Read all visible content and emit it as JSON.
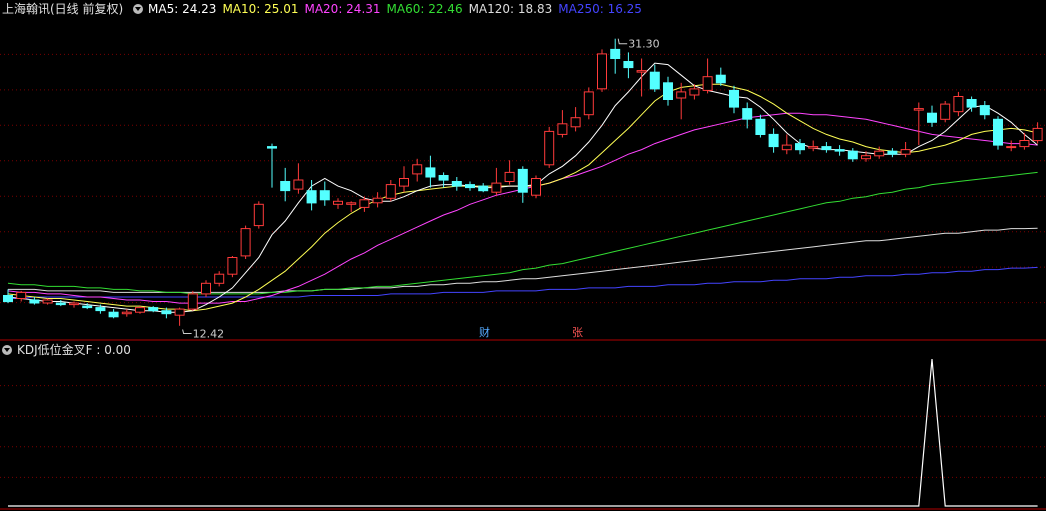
{
  "main_legend": {
    "title": "上海翰讯(日线 前复权)",
    "items": [
      {
        "label": "MA5: 24.23",
        "color": "#ffffff"
      },
      {
        "label": "MA10: 25.01",
        "color": "#ffff55"
      },
      {
        "label": "MA20: 24.31",
        "color": "#ff44ff"
      },
      {
        "label": "MA60: 22.46",
        "color": "#33dd33"
      },
      {
        "label": "MA120: 18.83",
        "color": "#dddddd"
      },
      {
        "label": "MA250: 16.25",
        "color": "#4444ff"
      }
    ]
  },
  "sub_legend": {
    "title": "KDJ低位金叉F : 0.00"
  },
  "events": [
    {
      "label": "财",
      "color": "#55aaff"
    },
    {
      "label": "张",
      "color": "#ff5555"
    }
  ],
  "colors": {
    "up": "#ff3b3b",
    "down": "#54ffff",
    "grid": "#7a0000",
    "border": "#b00000"
  },
  "chart_data": [
    {
      "type": "candlestick",
      "title": "上海翰讯(日线 前复权)",
      "y_range": [
        11.6,
        32.6
      ],
      "annotations": [
        {
          "label": "12.42",
          "kind": "low",
          "value": 12.42
        },
        {
          "label": "31.30",
          "kind": "high",
          "value": 31.3
        }
      ],
      "candles": [
        [
          14.4,
          14.0,
          14.8,
          13.9
        ],
        [
          14.2,
          14.6,
          14.7,
          14.0
        ],
        [
          14.1,
          13.9,
          14.3,
          13.8
        ],
        [
          13.9,
          14.1,
          14.2,
          13.8
        ],
        [
          13.9,
          13.8,
          14.1,
          13.7
        ],
        [
          13.8,
          13.9,
          14.0,
          13.6
        ],
        [
          13.7,
          13.6,
          13.9,
          13.5
        ],
        [
          13.6,
          13.4,
          13.8,
          13.2
        ],
        [
          13.3,
          13.0,
          13.5,
          12.9
        ],
        [
          13.2,
          13.3,
          13.5,
          13.0
        ],
        [
          13.3,
          13.6,
          13.7,
          13.2
        ],
        [
          13.6,
          13.4,
          13.7,
          13.3
        ],
        [
          13.4,
          13.2,
          13.6,
          12.9
        ],
        [
          13.1,
          13.5,
          13.6,
          12.4
        ],
        [
          13.5,
          14.5,
          14.7,
          13.4
        ],
        [
          14.5,
          15.2,
          15.4,
          14.3
        ],
        [
          15.2,
          15.8,
          16.0,
          15.0
        ],
        [
          15.8,
          16.9,
          17.0,
          15.6
        ],
        [
          17.0,
          18.8,
          19.0,
          16.8
        ],
        [
          19.0,
          20.4,
          20.6,
          18.8
        ],
        [
          24.2,
          24.1,
          24.4,
          21.5
        ],
        [
          21.9,
          21.3,
          22.8,
          20.6
        ],
        [
          21.4,
          22.0,
          23.1,
          21.1
        ],
        [
          21.3,
          20.5,
          22.0,
          20.0
        ],
        [
          21.3,
          20.7,
          21.9,
          20.3
        ],
        [
          20.4,
          20.6,
          20.8,
          20.1
        ],
        [
          20.4,
          20.5,
          20.6,
          19.9
        ],
        [
          20.2,
          20.7,
          20.9,
          19.9
        ],
        [
          20.5,
          20.8,
          21.2,
          20.2
        ],
        [
          20.8,
          21.7,
          22.0,
          20.6
        ],
        [
          21.6,
          22.1,
          22.9,
          21.2
        ],
        [
          22.4,
          23.0,
          23.4,
          21.9
        ],
        [
          22.8,
          22.2,
          23.6,
          21.5
        ],
        [
          22.3,
          22.0,
          22.5,
          21.5
        ],
        [
          21.9,
          21.6,
          22.2,
          21.3
        ],
        [
          21.7,
          21.5,
          21.9,
          21.3
        ],
        [
          21.6,
          21.3,
          21.8,
          21.2
        ],
        [
          21.2,
          21.8,
          22.8,
          21.0
        ],
        [
          21.9,
          22.5,
          23.3,
          21.7
        ],
        [
          22.7,
          21.2,
          22.9,
          20.5
        ],
        [
          21.0,
          22.1,
          22.3,
          20.8
        ],
        [
          23.0,
          25.2,
          25.5,
          22.8
        ],
        [
          25.0,
          25.7,
          26.6,
          24.8
        ],
        [
          25.5,
          26.1,
          26.8,
          25.2
        ],
        [
          26.3,
          27.8,
          28.1,
          26.0
        ],
        [
          28.0,
          30.3,
          30.6,
          27.8
        ],
        [
          30.6,
          30.0,
          31.3,
          29.0
        ],
        [
          29.8,
          29.4,
          30.4,
          28.7
        ],
        [
          29.1,
          29.2,
          30.0,
          27.5
        ],
        [
          29.1,
          28.0,
          29.6,
          27.8
        ],
        [
          28.4,
          27.3,
          28.8,
          26.9
        ],
        [
          27.4,
          27.8,
          28.4,
          26.0
        ],
        [
          27.6,
          28.0,
          28.3,
          27.3
        ],
        [
          27.9,
          28.8,
          30.0,
          27.7
        ],
        [
          28.9,
          28.4,
          29.4,
          28.2
        ],
        [
          27.9,
          26.8,
          28.2,
          26.4
        ],
        [
          26.7,
          26.0,
          27.1,
          25.4
        ],
        [
          26.0,
          25.0,
          26.3,
          24.8
        ],
        [
          25.0,
          24.2,
          25.4,
          23.8
        ],
        [
          24.0,
          24.3,
          25.0,
          23.7
        ],
        [
          24.4,
          24.0,
          24.7,
          23.7
        ],
        [
          24.1,
          24.2,
          24.6,
          23.9
        ],
        [
          24.2,
          24.0,
          24.5,
          23.8
        ],
        [
          24.0,
          23.9,
          24.3,
          23.6
        ],
        [
          23.9,
          23.4,
          24.1,
          23.2
        ],
        [
          23.4,
          23.6,
          23.9,
          23.2
        ],
        [
          23.6,
          23.9,
          24.2,
          23.4
        ],
        [
          23.9,
          23.7,
          24.1,
          23.5
        ],
        [
          23.7,
          24.0,
          24.5,
          23.5
        ],
        [
          26.6,
          26.7,
          27.1,
          24.3
        ],
        [
          26.4,
          25.8,
          26.9,
          25.5
        ],
        [
          26.0,
          27.0,
          27.2,
          25.8
        ],
        [
          26.5,
          27.5,
          27.8,
          26.2
        ],
        [
          27.3,
          26.8,
          27.5,
          26.5
        ],
        [
          26.9,
          26.3,
          27.2,
          26.0
        ],
        [
          26.0,
          24.3,
          26.2,
          24.0
        ],
        [
          24.2,
          24.2,
          24.6,
          23.9
        ],
        [
          24.2,
          24.6,
          25.1,
          24.0
        ],
        [
          24.6,
          25.4,
          25.8,
          24.4
        ]
      ],
      "series": [
        {
          "name": "MA5",
          "color": "#ffffff",
          "values": [
            14.3,
            14.2,
            14.1,
            14.0,
            14.0,
            13.9,
            13.8,
            13.7,
            13.6,
            13.5,
            13.4,
            13.4,
            13.3,
            13.3,
            13.4,
            13.8,
            14.3,
            14.9,
            15.9,
            16.9,
            18.4,
            19.3,
            20.5,
            21.6,
            22.1,
            21.6,
            21.3,
            20.8,
            20.6,
            20.6,
            20.9,
            21.3,
            21.6,
            21.7,
            21.7,
            21.6,
            21.5,
            21.5,
            21.6,
            21.6,
            21.7,
            22.4,
            22.9,
            23.6,
            24.5,
            25.6,
            26.9,
            27.8,
            28.8,
            29.7,
            29.6,
            28.9,
            28.2,
            27.9,
            27.7,
            27.5,
            27.4,
            26.8,
            26.0,
            25.1,
            24.4,
            24.1,
            24.0,
            24.0,
            23.9,
            23.8,
            23.7,
            23.7,
            23.7,
            24.2,
            24.6,
            25.2,
            26.0,
            26.8,
            26.9,
            26.4,
            25.8,
            25.0,
            24.3
          ]
        },
        {
          "name": "MA10",
          "color": "#ffff55",
          "values": [
            14.5,
            14.4,
            14.3,
            14.2,
            14.2,
            14.1,
            14.0,
            13.9,
            13.8,
            13.7,
            13.7,
            13.6,
            13.5,
            13.5,
            13.4,
            13.5,
            13.7,
            13.9,
            14.3,
            14.8,
            15.4,
            16.0,
            16.8,
            17.6,
            18.5,
            19.2,
            19.8,
            20.3,
            20.7,
            21.0,
            21.2,
            21.3,
            21.4,
            21.5,
            21.6,
            21.6,
            21.6,
            21.6,
            21.6,
            21.6,
            21.6,
            21.8,
            22.1,
            22.5,
            23.0,
            23.8,
            24.6,
            25.4,
            26.3,
            27.2,
            27.8,
            28.1,
            28.2,
            28.3,
            28.3,
            28.1,
            27.9,
            27.5,
            27.0,
            26.4,
            25.9,
            25.4,
            25.0,
            24.7,
            24.5,
            24.2,
            24.0,
            23.9,
            23.8,
            23.9,
            24.1,
            24.3,
            24.6,
            25.0,
            25.2,
            25.3,
            25.4,
            25.3,
            25.1
          ]
        },
        {
          "name": "MA20",
          "color": "#ff44ff",
          "values": [
            14.7,
            14.6,
            14.6,
            14.5,
            14.5,
            14.4,
            14.3,
            14.3,
            14.2,
            14.1,
            14.1,
            14.0,
            14.0,
            13.9,
            13.9,
            13.9,
            13.9,
            14.0,
            14.0,
            14.2,
            14.4,
            14.7,
            15.0,
            15.4,
            15.8,
            16.3,
            16.8,
            17.2,
            17.7,
            18.1,
            18.5,
            18.9,
            19.3,
            19.7,
            20.0,
            20.4,
            20.7,
            21.0,
            21.2,
            21.4,
            21.6,
            21.8,
            22.1,
            22.3,
            22.6,
            22.9,
            23.3,
            23.7,
            24.0,
            24.4,
            24.7,
            25.0,
            25.3,
            25.5,
            25.7,
            25.9,
            26.1,
            26.2,
            26.3,
            26.4,
            26.4,
            26.3,
            26.3,
            26.2,
            26.1,
            26.0,
            25.8,
            25.6,
            25.4,
            25.2,
            25.0,
            24.9,
            24.8,
            24.7,
            24.6,
            24.5,
            24.4,
            24.4,
            24.3
          ]
        },
        {
          "name": "MA60",
          "color": "#33dd33",
          "values": [
            15.2,
            15.1,
            15.1,
            15.0,
            15.0,
            15.0,
            14.9,
            14.9,
            14.8,
            14.8,
            14.7,
            14.7,
            14.6,
            14.6,
            14.5,
            14.5,
            14.5,
            14.5,
            14.5,
            14.5,
            14.6,
            14.6,
            14.7,
            14.7,
            14.8,
            14.8,
            14.9,
            14.9,
            15.0,
            15.0,
            15.1,
            15.2,
            15.3,
            15.4,
            15.5,
            15.6,
            15.7,
            15.8,
            15.9,
            16.1,
            16.2,
            16.4,
            16.5,
            16.7,
            16.9,
            17.1,
            17.3,
            17.5,
            17.7,
            17.9,
            18.1,
            18.3,
            18.5,
            18.7,
            18.9,
            19.1,
            19.3,
            19.5,
            19.7,
            19.9,
            20.1,
            20.3,
            20.5,
            20.6,
            20.8,
            20.9,
            21.1,
            21.2,
            21.4,
            21.5,
            21.7,
            21.8,
            21.9,
            22.0,
            22.1,
            22.2,
            22.3,
            22.4,
            22.5
          ]
        },
        {
          "name": "MA120",
          "color": "#dddddd",
          "values": [
            14.8,
            14.8,
            14.8,
            14.7,
            14.7,
            14.7,
            14.7,
            14.7,
            14.6,
            14.6,
            14.6,
            14.6,
            14.6,
            14.6,
            14.6,
            14.6,
            14.6,
            14.6,
            14.6,
            14.6,
            14.6,
            14.7,
            14.7,
            14.7,
            14.8,
            14.8,
            14.8,
            14.9,
            14.9,
            14.9,
            15.0,
            15.0,
            15.1,
            15.1,
            15.2,
            15.2,
            15.3,
            15.3,
            15.4,
            15.5,
            15.5,
            15.6,
            15.7,
            15.8,
            15.9,
            16.0,
            16.1,
            16.2,
            16.3,
            16.4,
            16.5,
            16.6,
            16.7,
            16.8,
            16.9,
            17.0,
            17.1,
            17.2,
            17.3,
            17.4,
            17.5,
            17.6,
            17.7,
            17.8,
            17.9,
            18.0,
            18.0,
            18.1,
            18.2,
            18.3,
            18.4,
            18.5,
            18.5,
            18.6,
            18.7,
            18.7,
            18.8,
            18.8,
            18.83
          ]
        },
        {
          "name": "MA250",
          "color": "#4444ff",
          "values": [
            14.2,
            14.2,
            14.3,
            14.3,
            14.3,
            14.3,
            14.3,
            14.3,
            14.3,
            14.3,
            14.3,
            14.3,
            14.3,
            14.3,
            14.3,
            14.3,
            14.3,
            14.3,
            14.3,
            14.3,
            14.3,
            14.3,
            14.3,
            14.4,
            14.4,
            14.4,
            14.4,
            14.4,
            14.4,
            14.5,
            14.5,
            14.5,
            14.5,
            14.6,
            14.6,
            14.6,
            14.6,
            14.7,
            14.7,
            14.7,
            14.7,
            14.8,
            14.8,
            14.8,
            14.9,
            14.9,
            14.9,
            15.0,
            15.0,
            15.0,
            15.1,
            15.1,
            15.1,
            15.2,
            15.2,
            15.3,
            15.3,
            15.3,
            15.4,
            15.4,
            15.5,
            15.5,
            15.5,
            15.6,
            15.6,
            15.7,
            15.7,
            15.7,
            15.8,
            15.8,
            15.9,
            15.9,
            16.0,
            16.0,
            16.1,
            16.1,
            16.2,
            16.2,
            16.25
          ]
        }
      ]
    },
    {
      "type": "line",
      "title": "KDJ低位金叉F : 0.00",
      "ylim": [
        0,
        1
      ],
      "series": [
        {
          "name": "KDJ低位金叉F",
          "color": "#ffffff",
          "values": [
            0,
            0,
            0,
            0,
            0,
            0,
            0,
            0,
            0,
            0,
            0,
            0,
            0,
            0,
            0,
            0,
            0,
            0,
            0,
            0,
            0,
            0,
            0,
            0,
            0,
            0,
            0,
            0,
            0,
            0,
            0,
            0,
            0,
            0,
            0,
            0,
            0,
            0,
            0,
            0,
            0,
            0,
            0,
            0,
            0,
            0,
            0,
            0,
            0,
            0,
            0,
            0,
            0,
            0,
            0,
            0,
            0,
            0,
            0,
            0,
            0,
            0,
            0,
            0,
            0,
            0,
            0,
            0,
            0,
            0,
            1,
            0,
            0,
            0,
            0,
            0,
            0,
            0,
            0
          ]
        }
      ]
    }
  ]
}
